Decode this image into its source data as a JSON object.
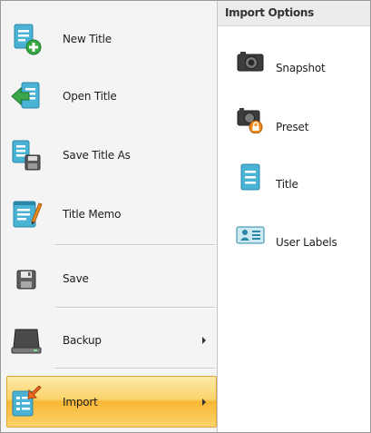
{
  "menu": {
    "items": [
      {
        "label": "New Title",
        "icon": "new-title-icon"
      },
      {
        "label": "Open Title",
        "icon": "open-title-icon"
      },
      {
        "label": "Save Title As",
        "icon": "save-title-as-icon"
      },
      {
        "label": "Title Memo",
        "icon": "title-memo-icon"
      },
      {
        "label": "Save",
        "icon": "save-icon"
      },
      {
        "label": "Backup",
        "icon": "backup-icon",
        "has_submenu": true
      },
      {
        "label": "Import",
        "icon": "import-icon",
        "has_submenu": true,
        "active": true
      }
    ]
  },
  "import_panel": {
    "header": "Import Options",
    "options": [
      {
        "label": "Snapshot",
        "icon": "camera-icon"
      },
      {
        "label": "Preset",
        "icon": "preset-camera-lock-icon"
      },
      {
        "label": "Title",
        "icon": "title-document-icon"
      },
      {
        "label": "User Labels",
        "icon": "user-labels-icon"
      }
    ]
  },
  "colors": {
    "highlight_top": "#fde9a8",
    "highlight_bottom": "#f8b735",
    "icon_teal": "#3fa6c8",
    "icon_green": "#3aa84a",
    "icon_orange": "#f08c1e"
  }
}
